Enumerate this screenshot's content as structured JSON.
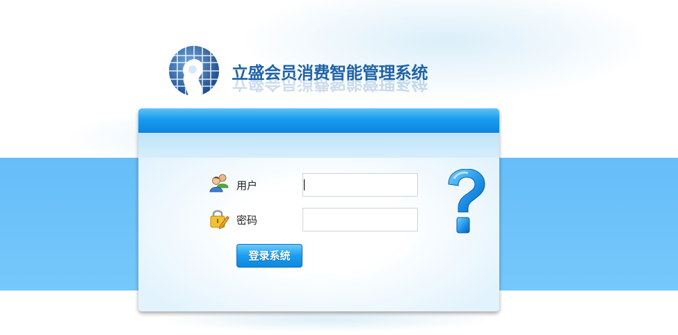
{
  "app": {
    "title": "立盛会员消费智能管理系统"
  },
  "login": {
    "username_label": "用户",
    "password_label": "密码",
    "username_value": "",
    "password_value": "",
    "submit_label": "登录系统"
  },
  "icons": {
    "logo": "globe-figure-logo",
    "user": "users-icon",
    "password": "lock-pencil-icon",
    "help": "question-mark-icon"
  },
  "colors": {
    "brand": "#1f63a8",
    "band": "#6fc4fa",
    "button": "#1a9df0"
  }
}
